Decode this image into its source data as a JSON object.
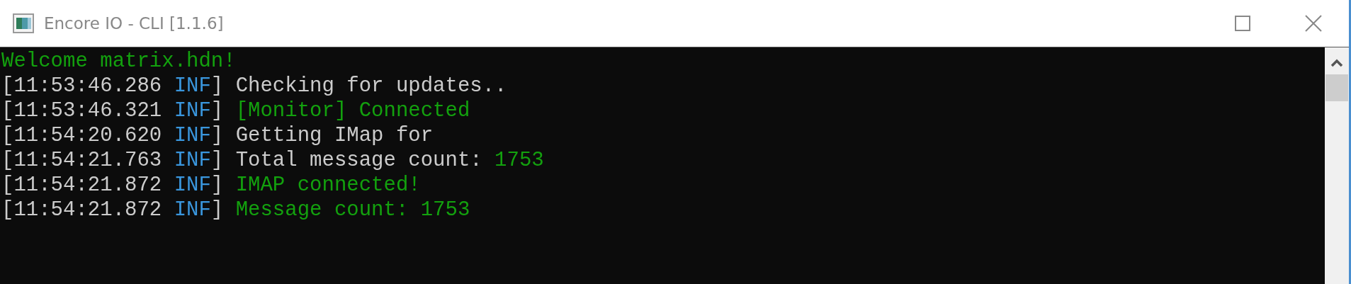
{
  "window": {
    "title": "Encore IO - CLI [1.1.6]"
  },
  "console": {
    "lines": [
      {
        "kind": "banner",
        "text": "Welcome matrix.hdn!",
        "color": "#13a10e"
      },
      {
        "kind": "log",
        "time": "[11:53:46.286",
        "level": {
          "text": "INF",
          "color": "#3a96dd"
        },
        "close": "]",
        "message": [
          {
            "text": "Checking for updates..",
            "color": "#cccccc"
          }
        ]
      },
      {
        "kind": "log",
        "time": "[11:53:46.321",
        "level": {
          "text": "INF",
          "color": "#3a96dd"
        },
        "close": "]",
        "message": [
          {
            "text": "[Monitor] Connected",
            "color": "#13a10e"
          }
        ]
      },
      {
        "kind": "log",
        "time": "[11:54:20.620",
        "level": {
          "text": "INF",
          "color": "#3a96dd"
        },
        "close": "]",
        "message": [
          {
            "text": "Getting IMap for",
            "color": "#cccccc"
          }
        ]
      },
      {
        "kind": "log",
        "time": "[11:54:21.763",
        "level": {
          "text": "INF",
          "color": "#3a96dd"
        },
        "close": "]",
        "message": [
          {
            "text": "Total message count:",
            "color": "#cccccc"
          },
          {
            "text": "1753",
            "color": "#13a10e"
          }
        ]
      },
      {
        "kind": "log",
        "time": "[11:54:21.872",
        "level": {
          "text": "INF",
          "color": "#3a96dd"
        },
        "close": "]",
        "message": [
          {
            "text": "IMAP connected!",
            "color": "#13a10e"
          }
        ]
      },
      {
        "kind": "log",
        "time": "[11:54:21.872",
        "level": {
          "text": "INF",
          "color": "#3a96dd"
        },
        "close": "]",
        "message": [
          {
            "text": "Message count: 1753",
            "color": "#13a10e"
          }
        ]
      }
    ]
  }
}
